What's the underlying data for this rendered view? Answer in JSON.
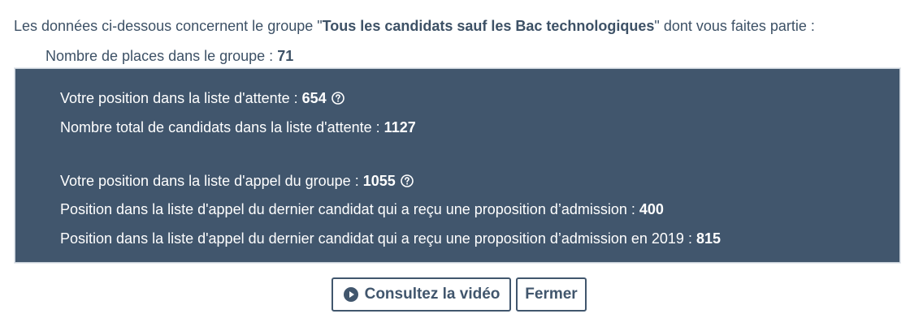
{
  "intro": {
    "prefix": "Les données ci-dessous concernent le groupe \"",
    "group_name": "Tous les candidats sauf les Bac technologiques",
    "suffix": "\" dont vous faites partie :"
  },
  "places": {
    "label": "Nombre de places dans le groupe :",
    "value": "71"
  },
  "panel": {
    "waitlist_position_label": "Votre position dans la liste d'attente :",
    "waitlist_position_value": "654",
    "waitlist_total_label": "Nombre total de candidats dans la liste d'attente :",
    "waitlist_total_value": "1127",
    "call_position_label": "Votre position dans la liste d'appel du groupe :",
    "call_position_value": "1055",
    "last_admitted_label": "Position dans la liste d'appel du dernier candidat qui a reçu une proposition d’admission :",
    "last_admitted_value": "400",
    "last_admitted_2019_label": "Position dans la liste d'appel du dernier candidat qui a reçu une proposition d’admission en 2019 :",
    "last_admitted_2019_value": "815"
  },
  "buttons": {
    "video_label": "Consultez la vidéo",
    "close_label": "Fermer"
  },
  "icons": {
    "help": "help-circle-icon",
    "play": "play-circle-icon"
  },
  "colors": {
    "panel_bg": "#41566d",
    "text": "#3d5166",
    "panel_text": "#ffffff"
  }
}
